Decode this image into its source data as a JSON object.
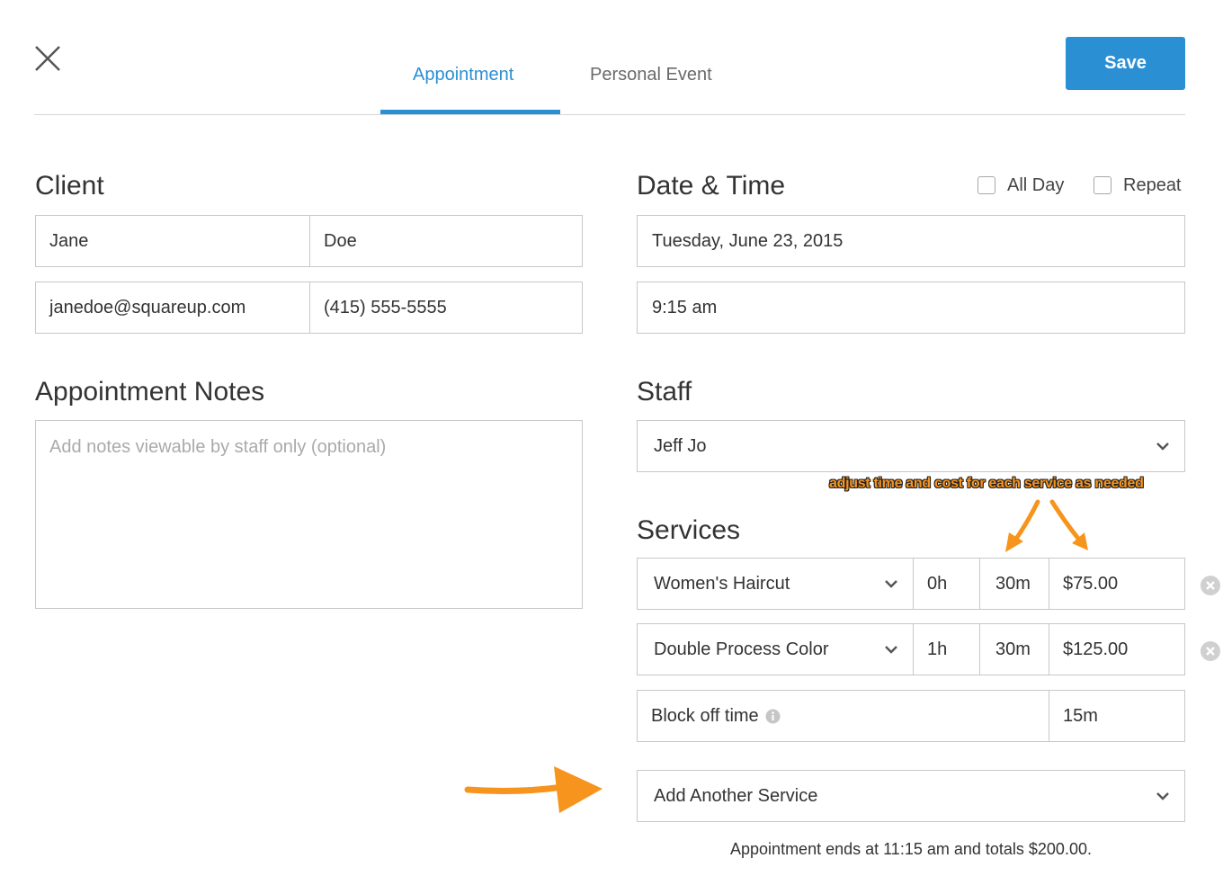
{
  "header": {
    "tabs": [
      {
        "label": "Appointment",
        "active": true
      },
      {
        "label": "Personal Event",
        "active": false
      }
    ],
    "save_label": "Save"
  },
  "client": {
    "title": "Client",
    "first_name": "Jane",
    "last_name": "Doe",
    "email": "janedoe@squareup.com",
    "phone": "(415) 555-5555"
  },
  "notes": {
    "title": "Appointment Notes",
    "placeholder": "Add notes viewable by staff only (optional)",
    "value": ""
  },
  "datetime": {
    "title": "Date & Time",
    "all_day_label": "All Day",
    "all_day_checked": false,
    "repeat_label": "Repeat",
    "repeat_checked": false,
    "date": "Tuesday, June 23, 2015",
    "time": "9:15 am"
  },
  "staff": {
    "title": "Staff",
    "selected": "Jeff Jo"
  },
  "annotation": {
    "text": "adjust time and cost for each service as needed",
    "color": "#f7941d"
  },
  "services": {
    "title": "Services",
    "items": [
      {
        "name": "Women's Haircut",
        "hours": "0h",
        "minutes": "30m",
        "price": "$75.00"
      },
      {
        "name": "Double Process Color",
        "hours": "1h",
        "minutes": "30m",
        "price": "$125.00"
      }
    ],
    "block_off": {
      "label": "Block off time",
      "minutes": "15m"
    },
    "add_another": "Add Another Service",
    "summary": "Appointment ends at 11:15 am and totals $200.00."
  },
  "colors": {
    "accent": "#2b8fd3",
    "annotation_arrow": "#f7941d",
    "border": "#c8c8c8"
  },
  "icons": [
    "close-icon",
    "chevron-down-icon",
    "remove-circle-icon",
    "info-icon",
    "annotation-arrow"
  ]
}
